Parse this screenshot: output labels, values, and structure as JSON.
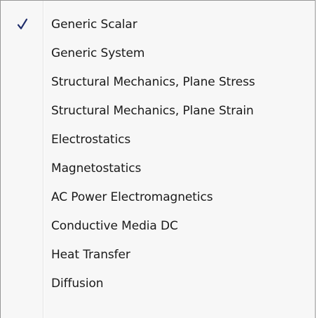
{
  "menu": {
    "items": [
      {
        "label": "Generic Scalar",
        "checked": true,
        "check_icon": "check-icon"
      },
      {
        "label": "Generic System",
        "checked": false
      },
      {
        "label": "Structural Mechanics, Plane Stress",
        "checked": false
      },
      {
        "label": "Structural Mechanics, Plane Strain",
        "checked": false
      },
      {
        "label": "Electrostatics",
        "checked": false
      },
      {
        "label": "Magnetostatics",
        "checked": false
      },
      {
        "label": "AC Power Electromagnetics",
        "checked": false
      },
      {
        "label": "Conductive Media DC",
        "checked": false
      },
      {
        "label": "Heat Transfer",
        "checked": false
      },
      {
        "label": "Diffusion",
        "checked": false
      }
    ],
    "colors": {
      "background": "#f7f7f7",
      "border": "#979797",
      "check": "#1f2d6b",
      "text": "#1a1a1a"
    }
  }
}
